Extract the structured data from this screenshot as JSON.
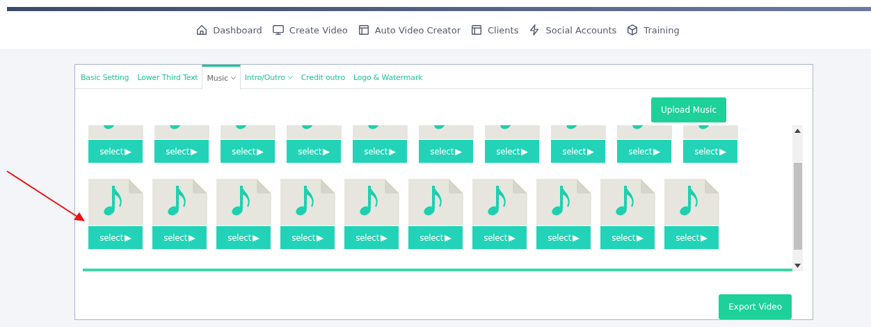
{
  "nav": [
    {
      "label": "Dashboard"
    },
    {
      "label": "Create Video"
    },
    {
      "label": "Auto Video Creator"
    },
    {
      "label": "Clients"
    },
    {
      "label": "Social Accounts"
    },
    {
      "label": "Training"
    }
  ],
  "tabs": [
    {
      "label": "Basic Setting",
      "selected": false,
      "dropdown": false
    },
    {
      "label": "Lower Third Text",
      "selected": false,
      "dropdown": false
    },
    {
      "label": "Music",
      "selected": true,
      "dropdown": true
    },
    {
      "label": "Intro/Outro",
      "selected": false,
      "dropdown": true
    },
    {
      "label": "Credit outro",
      "selected": false,
      "dropdown": false
    },
    {
      "label": "Logo & Watermark",
      "selected": false,
      "dropdown": false
    }
  ],
  "upload_button": "Upload Music",
  "track_rows": [
    {
      "clipped": true,
      "tracks": [
        {
          "button": "select",
          "play": "▶"
        },
        {
          "button": "select",
          "play": "▶"
        },
        {
          "button": "select",
          "play": "▶"
        },
        {
          "button": "select",
          "play": "▶"
        },
        {
          "button": "select",
          "play": "▶"
        },
        {
          "button": "select",
          "play": "▶"
        },
        {
          "button": "select",
          "play": "▶"
        },
        {
          "button": "select",
          "play": "▶"
        },
        {
          "button": "select",
          "play": "▶"
        },
        {
          "button": "select",
          "play": "▶"
        }
      ]
    },
    {
      "clipped": false,
      "tracks": [
        {
          "button": "select",
          "play": "▶"
        },
        {
          "button": "select",
          "play": "▶"
        },
        {
          "button": "select",
          "play": "▶"
        },
        {
          "button": "select",
          "play": "▶"
        },
        {
          "button": "select",
          "play": "▶"
        },
        {
          "button": "select",
          "play": "▶"
        },
        {
          "button": "select",
          "play": "▶"
        },
        {
          "button": "select",
          "play": "▶"
        },
        {
          "button": "select",
          "play": "▶"
        },
        {
          "button": "select",
          "play": "▶"
        }
      ]
    }
  ],
  "export_button": "Export Video"
}
